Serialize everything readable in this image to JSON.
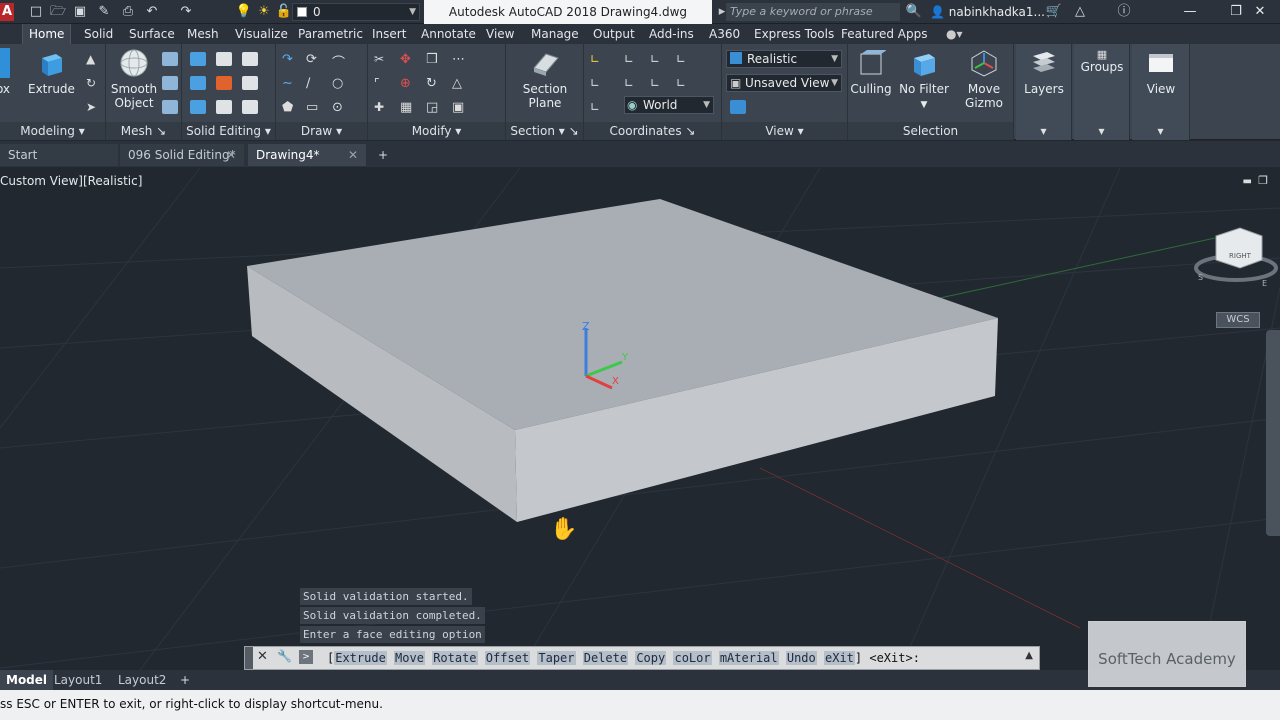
{
  "title_bar": {
    "app_title": "Autodesk AutoCAD 2018    Drawing4.dwg",
    "layer_value": "0",
    "search_placeholder": "Type a keyword or phrase",
    "username": "nabinkhadka1...",
    "icons": [
      "new-icon",
      "open-icon",
      "save-icon",
      "saveas-icon",
      "print-icon",
      "undo-icon",
      "redo-icon",
      "lightbulb-icon",
      "sun-icon",
      "lock-icon"
    ]
  },
  "ribbon_tabs": [
    "Home",
    "Solid",
    "Surface",
    "Mesh",
    "Visualize",
    "Parametric",
    "Insert",
    "Annotate",
    "View",
    "Manage",
    "Output",
    "Add-ins",
    "A360",
    "Express Tools",
    "Featured Apps"
  ],
  "active_tab": "Home",
  "ribbon": {
    "panels": {
      "modeling": "Modeling",
      "mesh": "Mesh",
      "solid_editing": "Solid Editing",
      "draw": "Draw",
      "modify": "Modify",
      "section": "Section",
      "coordinates": "Coordinates",
      "view": "View",
      "selection": "Selection"
    },
    "buttons": {
      "box": "ox",
      "extrude": "Extrude",
      "smooth_line1": "Smooth",
      "smooth_line2": "Object",
      "section_line1": "Section",
      "section_line2": "Plane",
      "culling": "Culling",
      "no_filter": "No Filter",
      "move_line1": "Move",
      "move_line2": "Gizmo",
      "layers": "Layers",
      "groups": "Groups",
      "view": "View"
    },
    "combos": {
      "visual_style": "Realistic",
      "named_view": "Unsaved View",
      "ucs": "World"
    }
  },
  "doc_tabs": [
    {
      "label": "Start"
    },
    {
      "label": "096 Solid Editing*"
    },
    {
      "label": "Drawing4*"
    }
  ],
  "viewport": {
    "view_label": "Custom View][Realistic]",
    "viewcube_label": "RIGHT",
    "wcs_label": "WCS",
    "axis_labels": {
      "z": "Z",
      "y": "Y",
      "x": "X"
    },
    "compass": {
      "south": "S",
      "east": "E"
    }
  },
  "command_history": [
    "Solid validation started.",
    "Solid validation completed.",
    "Enter a face editing option"
  ],
  "command_line": {
    "prefix": "[",
    "options": [
      "Extrude",
      "Move",
      "Rotate",
      "Offset",
      "Taper",
      "Delete",
      "Copy",
      "coLor",
      "mAterial",
      "Undo",
      "eXit"
    ],
    "suffix": "] <eXit>:"
  },
  "layout_tabs": [
    "Model",
    "Layout1",
    "Layout2"
  ],
  "status_bar": "ss ESC or ENTER to exit, or right-click to display shortcut-menu.",
  "watermark": "SoftTech Academy",
  "colors": {
    "viewport_bg": "#212830",
    "ribbon_bg": "#3b444f",
    "solid_top": "#a9aeb4",
    "solid_front": "#c4c7cb",
    "solid_side": "#b8bcc1"
  }
}
